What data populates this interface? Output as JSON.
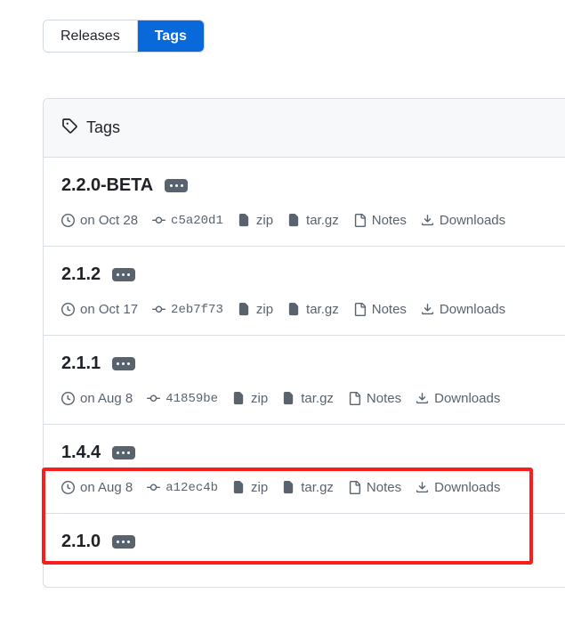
{
  "toolbar": {
    "tabs": [
      {
        "label": "Releases",
        "active": false
      },
      {
        "label": "Tags",
        "active": true
      }
    ]
  },
  "card": {
    "header": {
      "icon": "tag-icon",
      "label": "Tags"
    },
    "column_labels": {
      "zip": "zip",
      "targz": "tar.gz",
      "notes": "Notes",
      "downloads": "Downloads"
    },
    "rows": [
      {
        "name": "2.2.0-BETA",
        "date": "on Oct 28",
        "commit": "c5a20d1",
        "zip": "zip",
        "targz": "tar.gz",
        "notes": "Notes",
        "downloads": "Downloads"
      },
      {
        "name": "2.1.2",
        "date": "on Oct 17",
        "commit": "2eb7f73",
        "zip": "zip",
        "targz": "tar.gz",
        "notes": "Notes",
        "downloads": "Downloads"
      },
      {
        "name": "2.1.1",
        "date": "on Aug 8",
        "commit": "41859be",
        "zip": "zip",
        "targz": "tar.gz",
        "notes": "Notes",
        "downloads": "Downloads"
      },
      {
        "name": "1.4.4",
        "date": "on Aug 8",
        "commit": "a12ec4b",
        "zip": "zip",
        "targz": "tar.gz",
        "notes": "Notes",
        "downloads": "Downloads"
      },
      {
        "name": "2.1.0",
        "date": "",
        "commit": "",
        "zip": "",
        "targz": "",
        "notes": "",
        "downloads": ""
      }
    ]
  },
  "annotation": {
    "highlight_color": "#f81e1e",
    "highlighted_row": "1.4.4"
  },
  "colors": {
    "accent": "#0969da",
    "text": "#1f2328",
    "muted": "#59636e",
    "border": "#d8dee4",
    "header_bg": "#f6f8fa",
    "highlight": "#f81e1e"
  }
}
